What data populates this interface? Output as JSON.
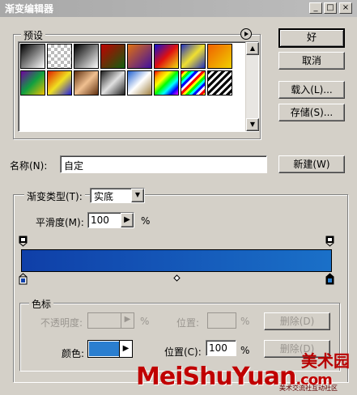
{
  "window": {
    "title": "渐变编辑器",
    "controls": [
      "_",
      "□",
      "×"
    ]
  },
  "presets": {
    "label": "预设",
    "menu_icon": "arrow-circle-icon"
  },
  "buttons": {
    "ok": "好",
    "cancel": "取消",
    "load": "载入(L)...",
    "save": "存储(S)...",
    "new": "新建(W)"
  },
  "name": {
    "label": "名称(N):",
    "value": "自定"
  },
  "gradient": {
    "type_label": "渐变类型(T):",
    "type_value": "实底",
    "smooth_label": "平滑度(M):",
    "smooth_value": "100",
    "percent": "%",
    "color_start": "#0f3fa8",
    "color_end": "#1a70c8"
  },
  "stops": {
    "group_label": "色标",
    "opacity_label": "不透明度:",
    "opacity_percent": "%",
    "opacity_location_label": "位置:",
    "opacity_location_percent": "%",
    "opacity_delete": "删除(D)",
    "color_label": "颜色:",
    "color_value": "#2a7ecf",
    "color_location_label": "位置(C):",
    "color_location_value": "100",
    "color_location_percent": "%",
    "color_delete": "删除(D)"
  },
  "watermark": {
    "brand": "MeiShuYuan",
    "domain": ".com",
    "cn_logo": "美术园",
    "cn_sub": "美术交流社互动社区"
  }
}
